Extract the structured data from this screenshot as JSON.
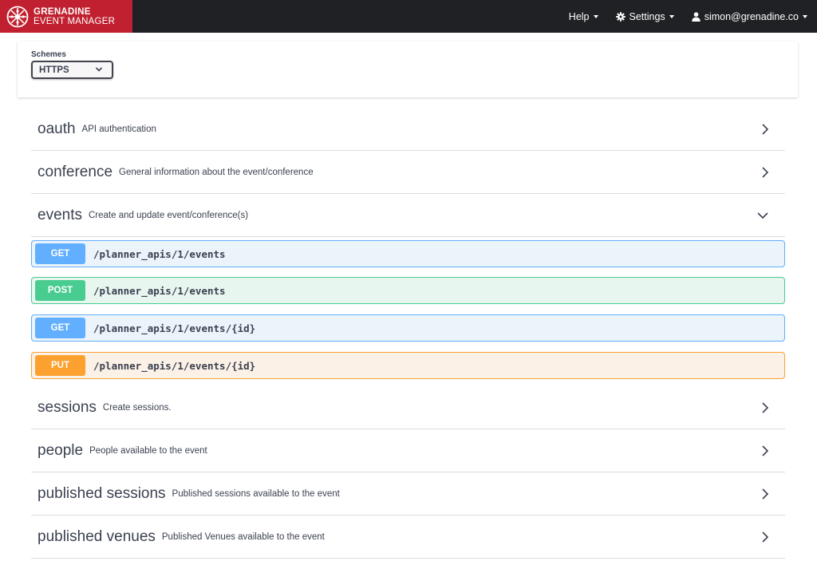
{
  "brand": {
    "line1": "GRENADINE",
    "line2": "EVENT MANAGER",
    "color": "#c0202f"
  },
  "nav": {
    "help": "Help",
    "settings": "Settings",
    "user": "simon@grenadine.co"
  },
  "schemes": {
    "title": "Schemes",
    "selected": "HTTPS"
  },
  "tags": [
    {
      "name": "oauth",
      "description": "API authentication",
      "expanded": false
    },
    {
      "name": "conference",
      "description": "General information about the event/conference",
      "expanded": false
    },
    {
      "name": "events",
      "description": "Create and update event/conference(s)",
      "expanded": true
    },
    {
      "name": "sessions",
      "description": "Create sessions.",
      "expanded": false
    },
    {
      "name": "people",
      "description": "People available to the event",
      "expanded": false
    },
    {
      "name": "published sessions",
      "description": "Published sessions available to the event",
      "expanded": false
    },
    {
      "name": "published venues",
      "description": "Published Venues available to the event",
      "expanded": false
    }
  ],
  "operations": [
    {
      "method": "GET",
      "path": "/planner_apis/1/events"
    },
    {
      "method": "POST",
      "path": "/planner_apis/1/events"
    },
    {
      "method": "GET",
      "path": "/planner_apis/1/events/{id}"
    },
    {
      "method": "PUT",
      "path": "/planner_apis/1/events/{id}"
    }
  ],
  "colors": {
    "get": "#61affe",
    "post": "#49cc90",
    "put": "#fca130",
    "topbar": "#202124"
  },
  "icons": {
    "logo": "grenadine-logo",
    "settings": "gear-icon",
    "user": "user-icon",
    "collapsed": "chevron-right-icon",
    "expanded": "chevron-down-icon"
  }
}
